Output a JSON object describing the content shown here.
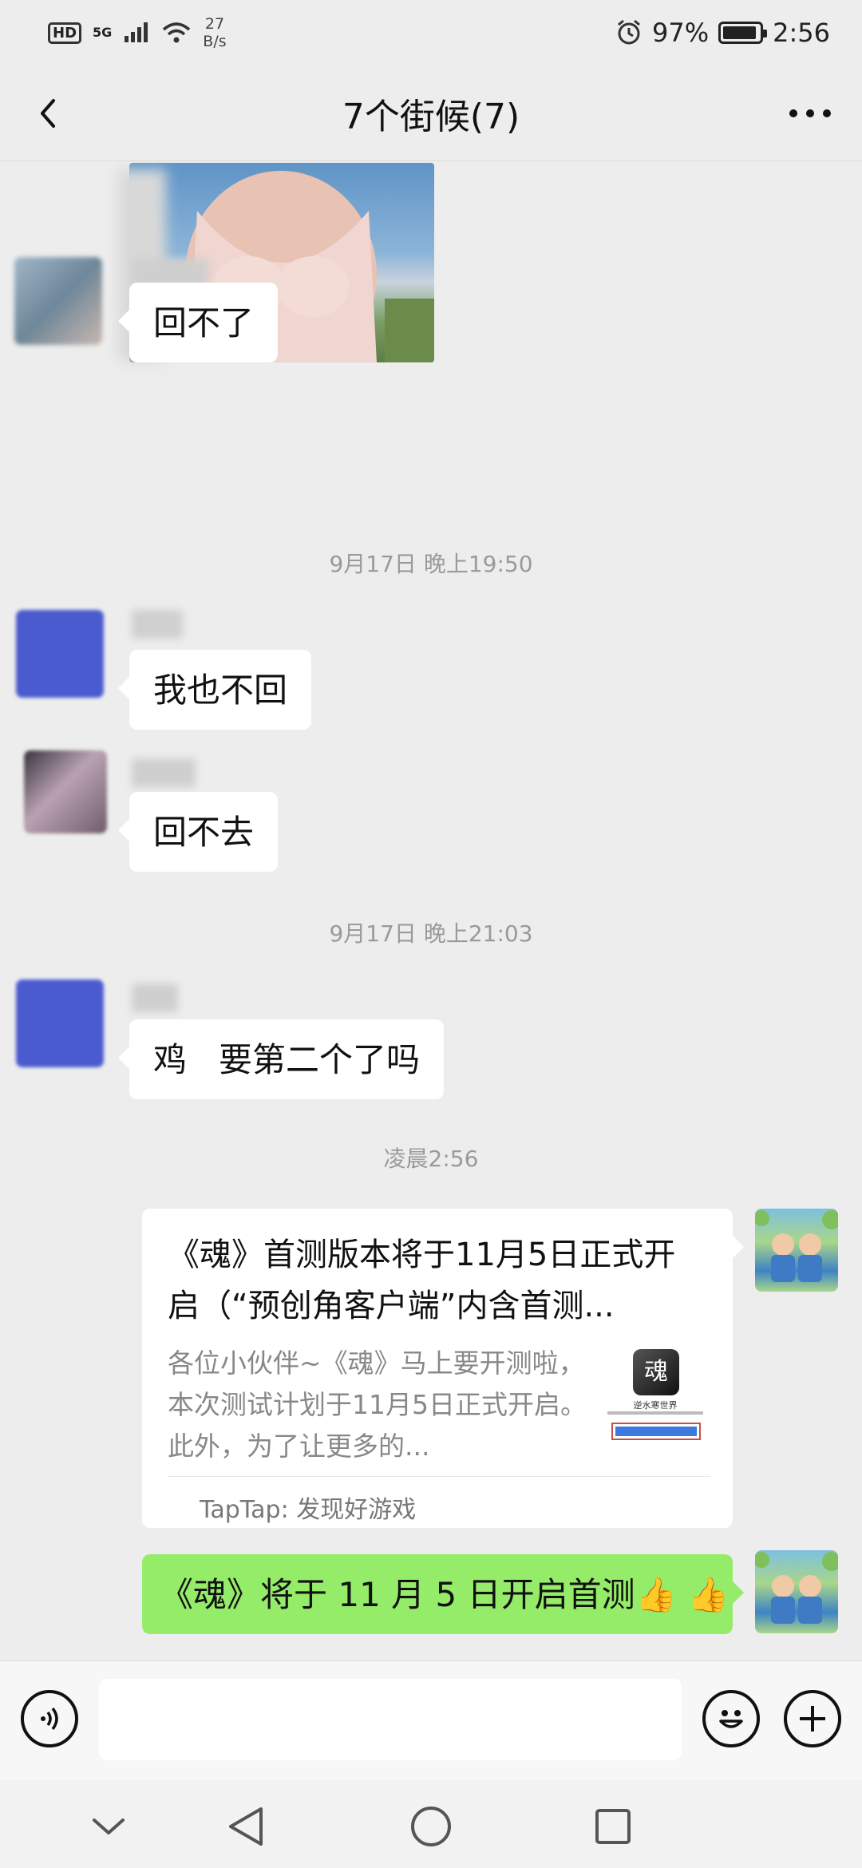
{
  "status_bar": {
    "hd": "HD",
    "network": "5G",
    "net_speed_value": "27",
    "net_speed_unit": "B/s",
    "battery": "97%",
    "time": "2:56"
  },
  "header": {
    "title": "7个街候(7)"
  },
  "messages": {
    "m1_text": "回不了",
    "ts1": "9月17日 晚上19:50",
    "m2_text": "我也不回",
    "m3_text": "回不去",
    "ts2": "9月17日 晚上21:03",
    "m4_text": "鸡   要第二个了吗",
    "ts3": "凌晨2:56",
    "link_card": {
      "title": "《魂》首测版本将于11月5日正式开启（“预创角客户端”内含首测...",
      "description": "各位小伙伴~《魂》马上要开测啦，本次测试计划于11月5日正式开启。此外，为了让更多的...",
      "source": "TapTap: 发现好游戏",
      "thumb_caption": "逆水寒世界"
    },
    "m5_text": "《魂》将于 11 月 5 日开启首测👍 👍"
  },
  "icons": {
    "back": "chevron-left-icon",
    "more": "more-dots-icon",
    "voice": "voice-icon",
    "emoji": "emoji-icon",
    "add": "plus-icon"
  },
  "colors": {
    "sent_bubble": "#95ec69",
    "background": "#ededed",
    "received_bubble": "#ffffff"
  }
}
